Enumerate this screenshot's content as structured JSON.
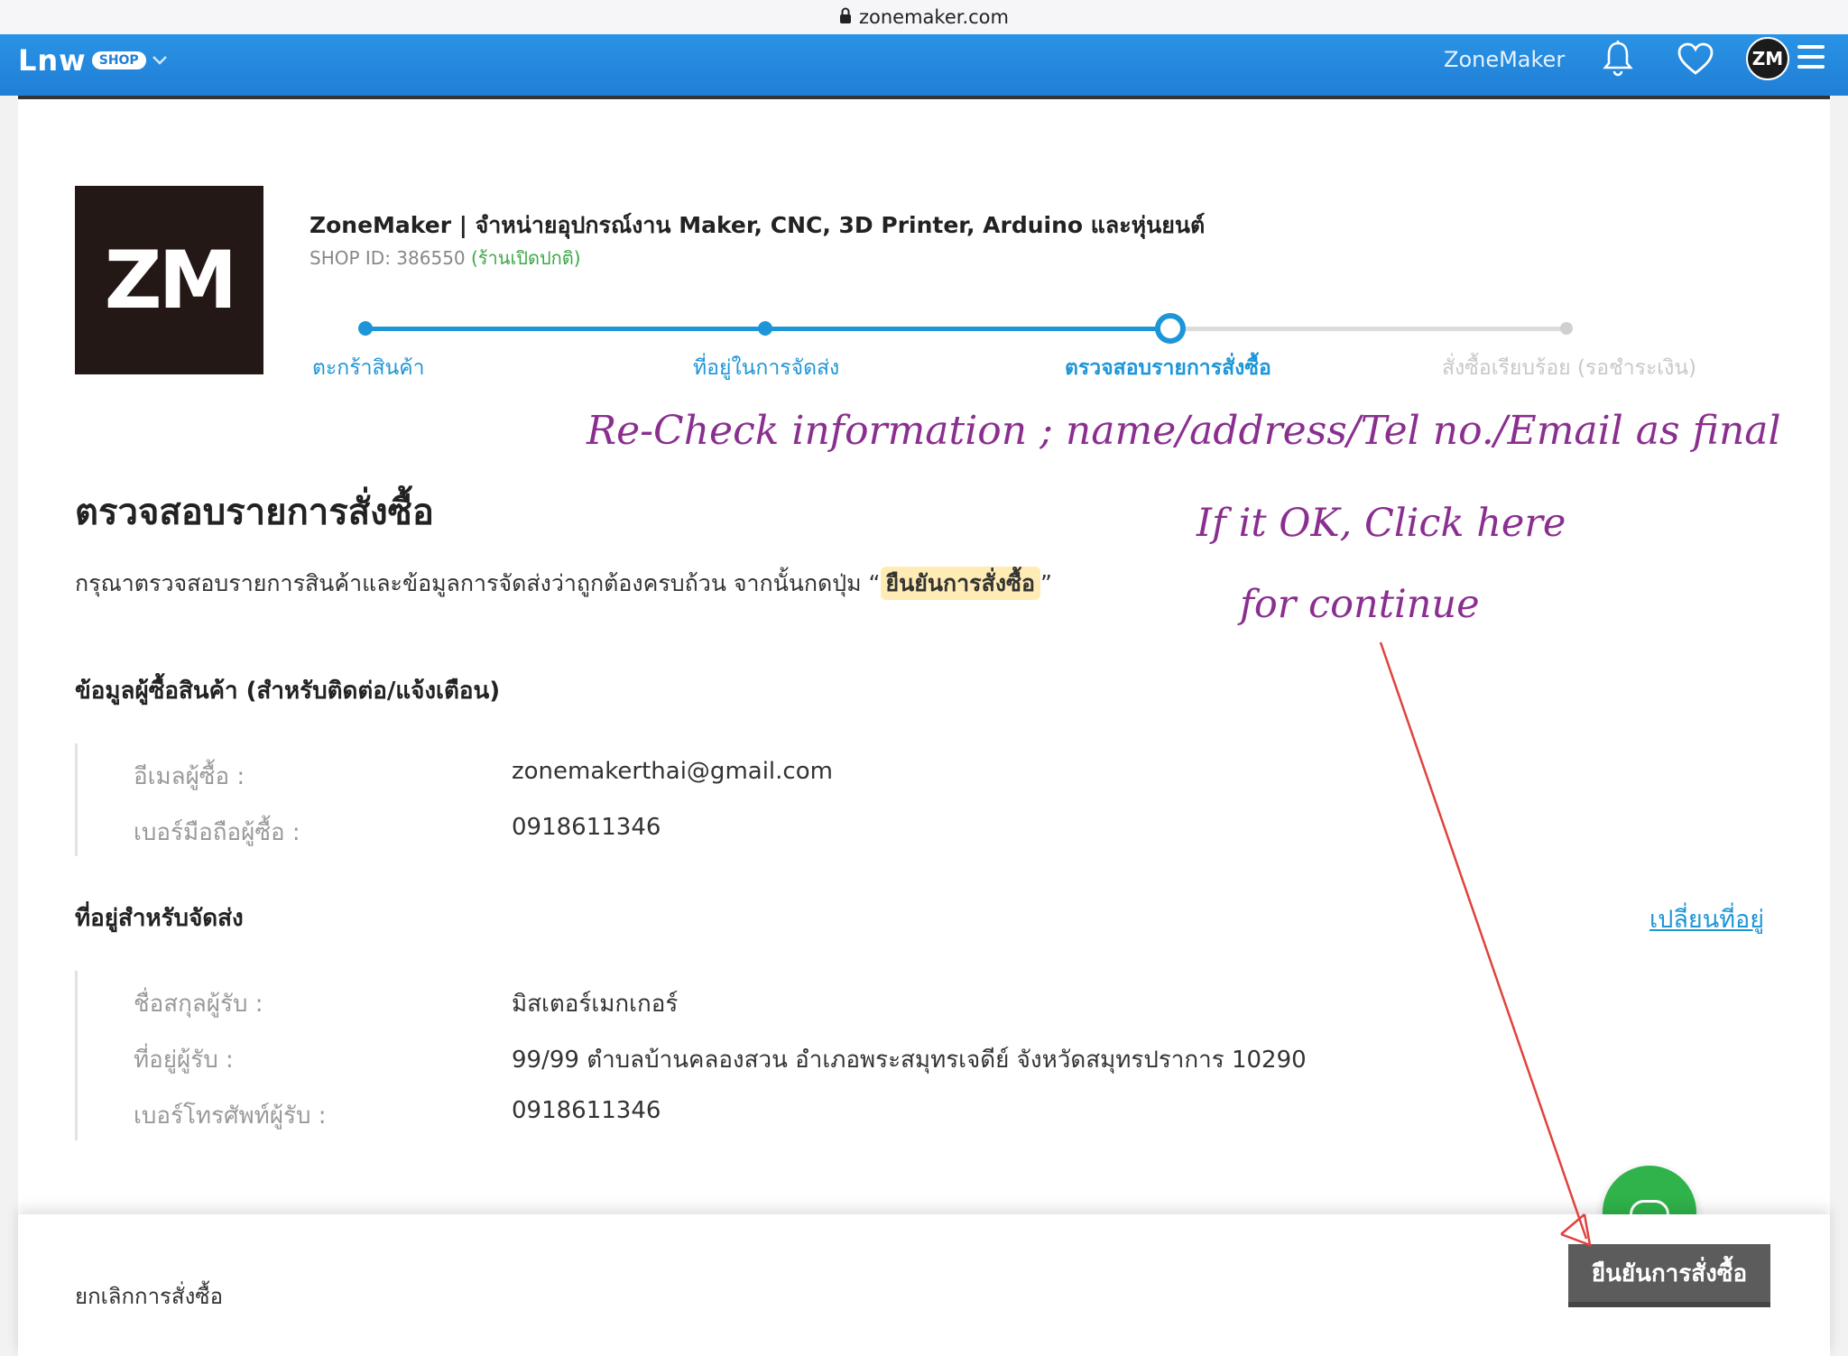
{
  "browser": {
    "url": "zonemaker.com"
  },
  "topnav": {
    "logo_text": "Lnw",
    "logo_badge": "SHOP",
    "shop_name": "ZoneMaker",
    "avatar_text": "ZM"
  },
  "shop": {
    "logo_text": "ZM",
    "title": "ZoneMaker | จำหน่ายอุปกรณ์งาน Maker, CNC, 3D Printer, Arduino และหุ่นยนต์",
    "id_label": "SHOP ID: 386550",
    "status": "(ร้านเปิดปกติ)"
  },
  "steps": [
    {
      "label": "ตะกร้าสินค้า",
      "state": "done"
    },
    {
      "label": "ที่อยู่ในการจัดส่ง",
      "state": "done"
    },
    {
      "label": "ตรวจสอบรายการสั่งซื้อ",
      "state": "active"
    },
    {
      "label": "สั่งซื้อเรียบร้อย (รอชำระเงิน)",
      "state": "pending"
    }
  ],
  "annotations": {
    "recheck": "Re-Check information ; name/address/Tel no./Email as final",
    "ok_line1": "If it OK, Click here",
    "ok_line2": "for continue",
    "color": "#8a2f8f"
  },
  "page": {
    "title": "ตรวจสอบรายการสั่งซื้อ",
    "instruction_prefix": "กรุณาตรวจสอบรายการสินค้าและข้อมูลการจัดส่งว่าถูกต้องครบถ้วน จากนั้นกดปุ่ม “",
    "instruction_highlight": "ยืนยันการสั่งซื้อ",
    "instruction_suffix": "”"
  },
  "buyer": {
    "section_title": "ข้อมูลผู้ซื้อสินค้า (สำหรับติดต่อ/แจ้งเตือน)",
    "email_label": "อีเมลผู้ซื้อ :",
    "email_value": "zonemakerthai@gmail.com",
    "phone_label": "เบอร์มือถือผู้ซื้อ :",
    "phone_value": "0918611346"
  },
  "shipping": {
    "section_title": "ที่อยู่สำหรับจัดส่ง",
    "change_link": "เปลี่ยนที่อยู่",
    "name_label": "ชื่อสกุลผู้รับ :",
    "name_value": "มิสเตอร์เมกเกอร์",
    "address_label": "ที่อยู่ผู้รับ :",
    "address_value": "99/99  ตำบลบ้านคลองสวน  อำเภอพระสมุทรเจดีย์  จังหวัดสมุทรปราการ  10290",
    "phone_label": "เบอร์โทรศัพท์ผู้รับ :",
    "phone_value": "0918611346"
  },
  "footer": {
    "cancel_label": "ยกเลิกการสั่งซื้อ",
    "confirm_label": "ยืนยันการสั่งซื้อ"
  },
  "colors": {
    "nav_blue": "#1f7fd6",
    "step_blue": "#1d96d8",
    "confirm_gray": "#5c5c5c",
    "chat_green": "#2fb34a"
  }
}
